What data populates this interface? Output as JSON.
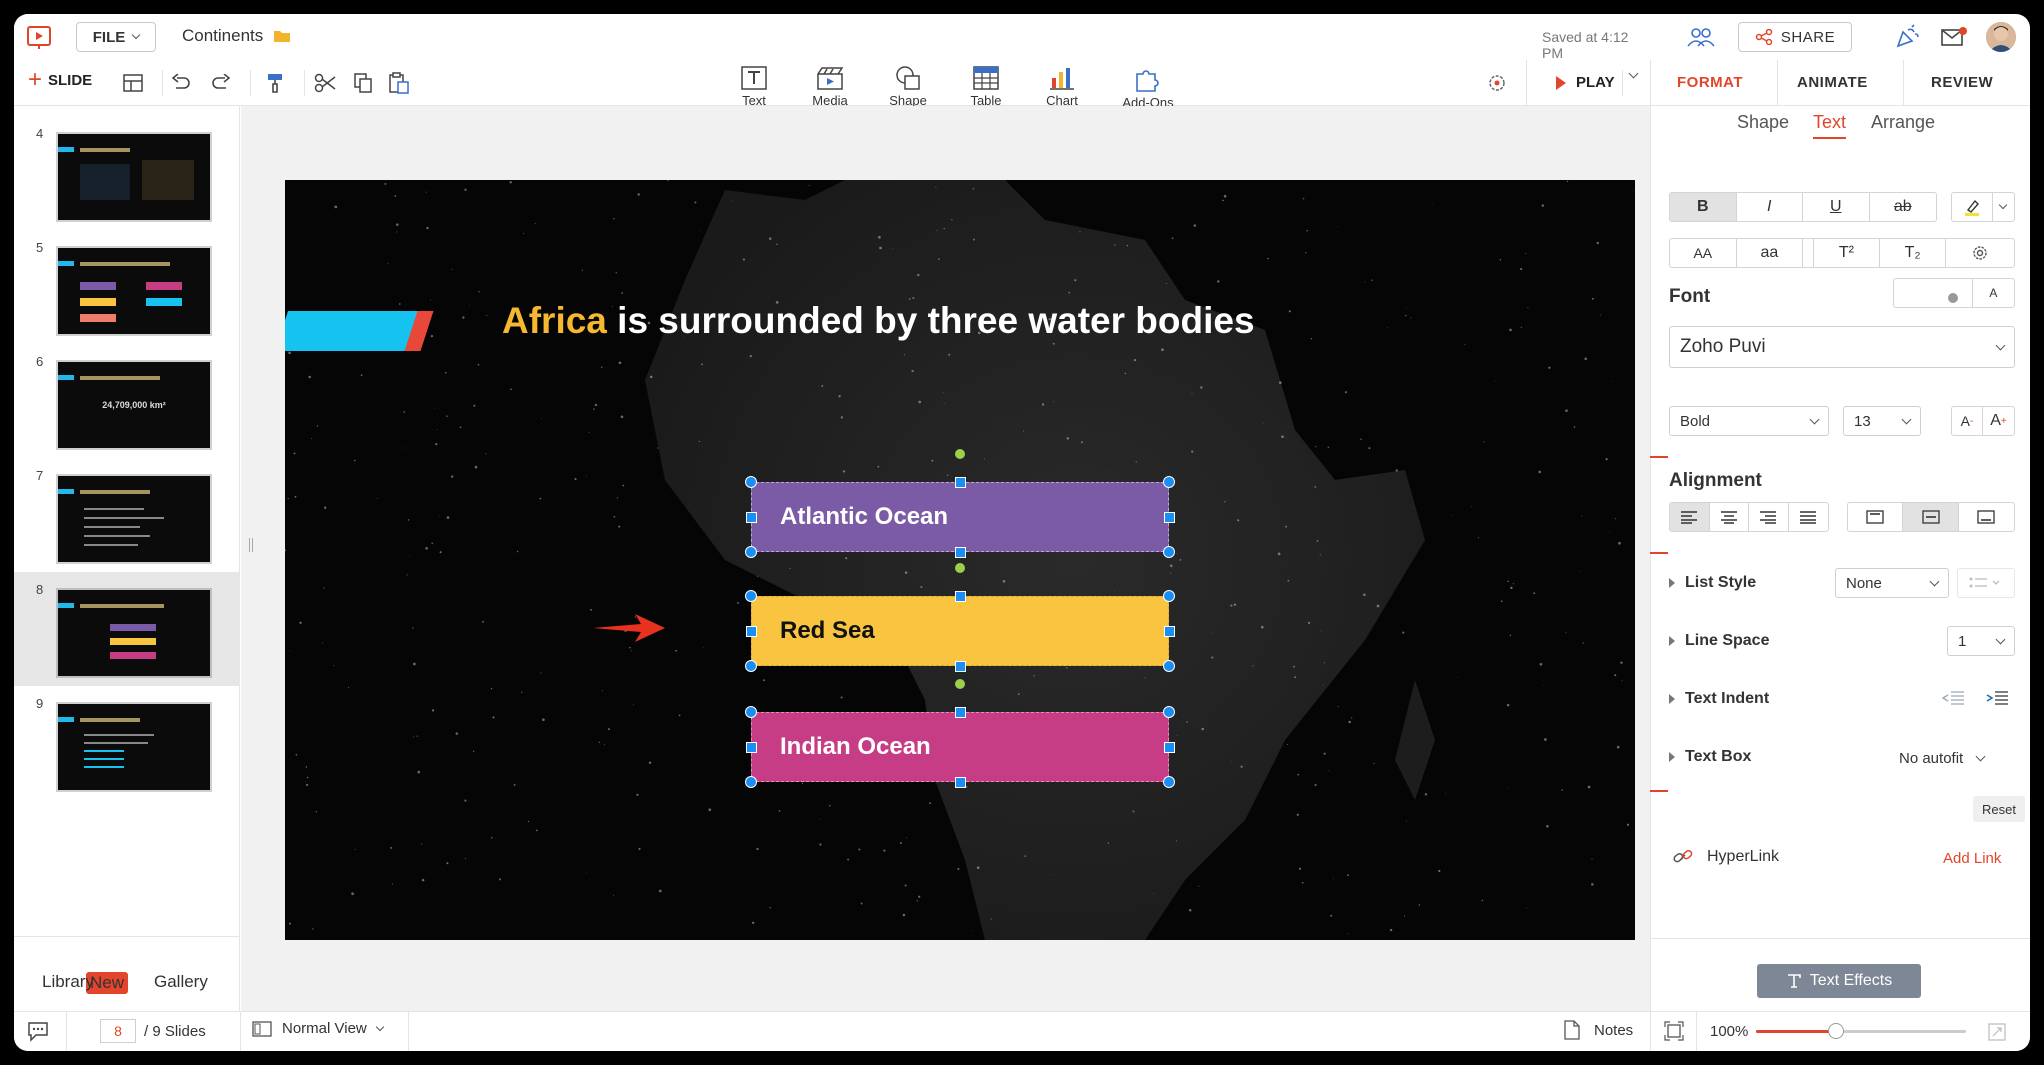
{
  "header": {
    "file_label": "FILE",
    "doc_title": "Continents",
    "saved_status": "Saved at 4:12 PM",
    "share_label": "SHARE"
  },
  "toolbar": {
    "slide_label": "SLIDE",
    "insert": [
      {
        "label": "Text",
        "icon": "text-box-icon"
      },
      {
        "label": "Media",
        "icon": "media-icon"
      },
      {
        "label": "Shape",
        "icon": "shape-icon"
      },
      {
        "label": "Table",
        "icon": "table-icon"
      },
      {
        "label": "Chart",
        "icon": "chart-icon"
      },
      {
        "label": "Add-Ons",
        "icon": "puzzle-icon"
      }
    ],
    "play_label": "PLAY"
  },
  "sidebar": {
    "slides": [
      {
        "num": "4"
      },
      {
        "num": "5"
      },
      {
        "num": "6",
        "big_text": "24,709,000 km²"
      },
      {
        "num": "7"
      },
      {
        "num": "8"
      },
      {
        "num": "9"
      }
    ],
    "library_label": "Library",
    "new_badge": "New",
    "gallery_label": "Gallery"
  },
  "slide": {
    "title_highlight": "Africa",
    "title_rest": " is surrounded by three water bodies",
    "boxes": [
      {
        "label": "Atlantic Ocean",
        "color": "#7b5ba6"
      },
      {
        "label": "Red Sea",
        "color": "#f9c440"
      },
      {
        "label": "Indian Ocean",
        "color": "#c63d86"
      }
    ]
  },
  "format_panel": {
    "tabs": [
      "FORMAT",
      "ANIMATE",
      "REVIEW"
    ],
    "active_tab": "FORMAT",
    "subtabs": [
      "Shape",
      "Text",
      "Arrange"
    ],
    "active_subtab": "Text",
    "style_buttons": [
      "B",
      "I",
      "U",
      "ab"
    ],
    "case_buttons": [
      "AA",
      "aa",
      "T²",
      "T₂"
    ],
    "font_label": "Font",
    "font_name": "Zoho Puvi",
    "font_weight": "Bold",
    "font_size": "13",
    "alignment_label": "Alignment",
    "list_style_label": "List Style",
    "list_style_value": "None",
    "line_space_label": "Line Space",
    "line_space_value": "1",
    "text_indent_label": "Text Indent",
    "text_box_label": "Text Box",
    "text_box_value": "No autofit",
    "reset_label": "Reset",
    "hyperlink_label": "HyperLink",
    "add_link_label": "Add Link",
    "text_effects_label": "Text Effects",
    "accent_color": "#e2452b"
  },
  "statusbar": {
    "current_page": "8",
    "total_pages": "/ 9 Slides",
    "view_mode": "Normal View",
    "notes_label": "Notes",
    "zoom_level": "100%",
    "zoom_fraction": 0.38
  }
}
